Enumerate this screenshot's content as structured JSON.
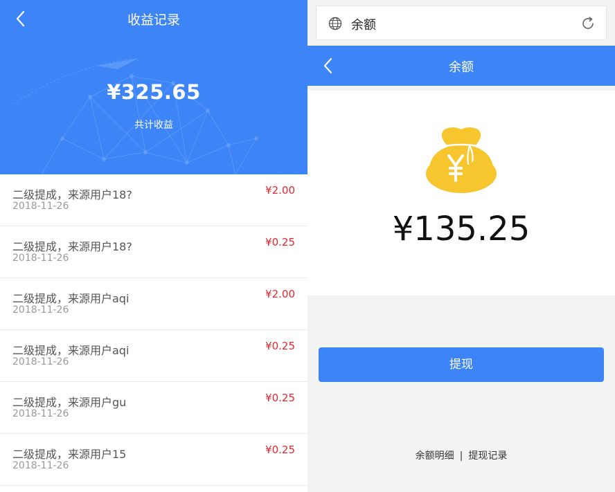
{
  "left_screen": {
    "title": "收益记录",
    "total_amount": "¥325.65",
    "total_label": "共计收益",
    "records": [
      {
        "title": "二级提成，来源用户18?",
        "date": "2018-11-26",
        "amount": "¥2.00"
      },
      {
        "title": "二级提成，来源用户18?",
        "date": "2018-11-26",
        "amount": "¥0.25"
      },
      {
        "title": "二级提成，来源用户aqi",
        "date": "2018-11-26",
        "amount": "¥2.00"
      },
      {
        "title": "二级提成，来源用户aqi",
        "date": "2018-11-26",
        "amount": "¥0.25"
      },
      {
        "title": "二级提成，来源用户gu",
        "date": "2018-11-26",
        "amount": "¥0.25"
      },
      {
        "title": "二级提成，来源用户15",
        "date": "2018-11-26",
        "amount": "¥0.25"
      }
    ]
  },
  "right_screen": {
    "url_bar_text": "余额",
    "nav_title": "余额",
    "balance_amount": "¥135.25",
    "withdraw_label": "提现",
    "links": {
      "balance_detail": "余额明细",
      "separator": "|",
      "withdraw_record": "提现记录"
    }
  },
  "icons": {
    "left_back": "chevron-left-icon",
    "right_back": "chevron-left-icon",
    "globe": "globe-icon",
    "reload": "reload-icon",
    "money_bag": "money-bag-icon"
  },
  "colors": {
    "primary_blue": "#3d85f6",
    "amount_red": "#e8262d",
    "bag_yellow": "#f7c52e"
  }
}
